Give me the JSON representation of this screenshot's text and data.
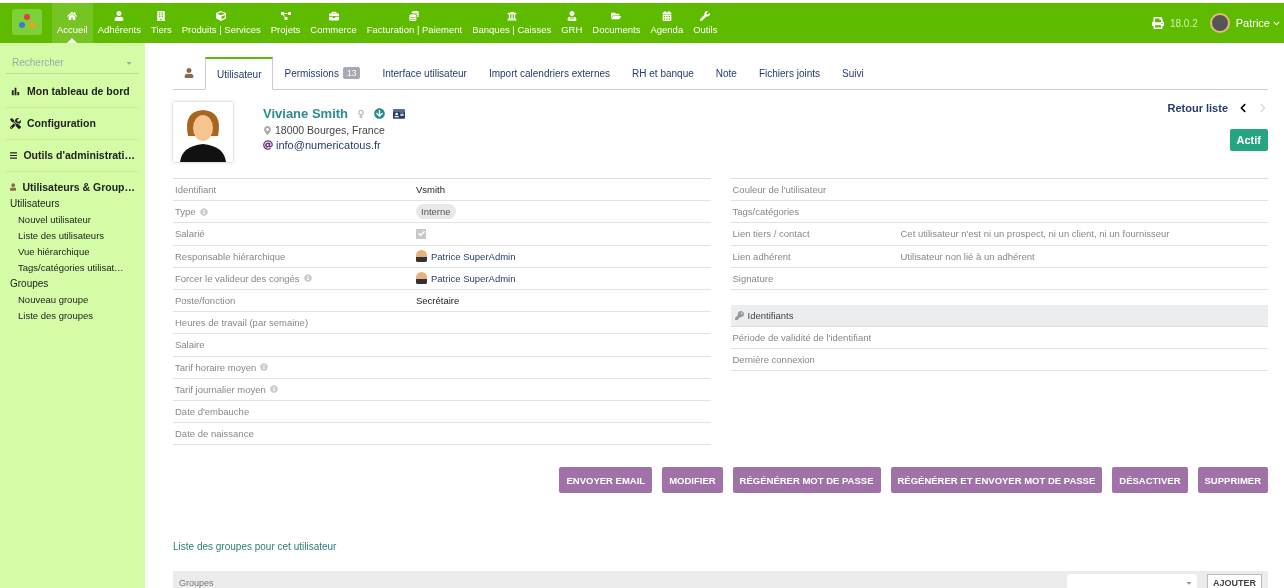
{
  "topbar": {
    "menu": [
      {
        "label": "Accueil",
        "selected": true
      },
      {
        "label": "Adhérents",
        "selected": false
      },
      {
        "label": "Tiers",
        "selected": false
      },
      {
        "label": "Produits | Services",
        "selected": false
      },
      {
        "label": "Projets",
        "selected": false
      },
      {
        "label": "Commerce",
        "selected": false
      },
      {
        "label": "Facturation | Paiement",
        "selected": false
      },
      {
        "label": "Banques | Caisses",
        "selected": false
      },
      {
        "label": "GRH",
        "selected": false
      },
      {
        "label": "Documents",
        "selected": false
      },
      {
        "label": "Agenda",
        "selected": false
      },
      {
        "label": "Outils",
        "selected": false
      }
    ],
    "version": "18.0.2",
    "user": "Patrice"
  },
  "sidebar": {
    "search": {
      "placeholder": "Rechercher"
    },
    "sections": [
      {
        "label": "Mon tableau de bord"
      },
      {
        "label": "Configuration"
      },
      {
        "label": "Outils d'administrati…"
      }
    ],
    "current": {
      "label": "Utilisateurs & Group…",
      "groups": [
        {
          "label": "Utilisateurs",
          "children": [
            {
              "label": "Nouvel utilisateur"
            },
            {
              "label": "Liste des utilisateurs"
            },
            {
              "label": "Vue hiérarchique"
            },
            {
              "label": "Tags/catégories utilisat…"
            }
          ]
        },
        {
          "label": "Groupes",
          "children": [
            {
              "label": "Nouveau groupe"
            },
            {
              "label": "Liste des groupes"
            }
          ]
        }
      ]
    }
  },
  "tabs": [
    {
      "label": "Utilisateur",
      "selected": true
    },
    {
      "label": "Permissions",
      "badge": "13",
      "selected": false
    },
    {
      "label": "Interface utilisateur",
      "selected": false
    },
    {
      "label": "Import calendriers externes",
      "selected": false
    },
    {
      "label": "RH et banque",
      "selected": false
    },
    {
      "label": "Note",
      "selected": false
    },
    {
      "label": "Fichiers joints",
      "selected": false
    },
    {
      "label": "Suivi",
      "selected": false
    }
  ],
  "profile": {
    "name": "Viviane Smith",
    "address": "18000 Bourges, France",
    "email": "info@numericatous.fr",
    "back_link": "Retour liste",
    "status": "Actif"
  },
  "left_fields": [
    {
      "label": "Identifiant",
      "info": false,
      "kind": "text",
      "value": "Vsmith"
    },
    {
      "label": "Type",
      "info": true,
      "kind": "badge",
      "value": "Interne"
    },
    {
      "label": "Salarié",
      "info": false,
      "kind": "checkbox",
      "checked": true
    },
    {
      "label": "Responsable hiérarchique",
      "info": false,
      "kind": "user",
      "value": "Patrice SuperAdmin"
    },
    {
      "label": "Forcer le valideur des congés",
      "info": true,
      "kind": "user",
      "value": "Patrice SuperAdmin"
    },
    {
      "label": "Poste/fonction",
      "info": false,
      "kind": "text",
      "value": "Secrétaire"
    },
    {
      "label": "Heures de travail (par semaine)",
      "info": false,
      "kind": "empty"
    },
    {
      "label": "Salaire",
      "info": false,
      "kind": "empty"
    },
    {
      "label": "Tarif horaire moyen",
      "info": true,
      "kind": "empty"
    },
    {
      "label": "Tarif journalier moyen",
      "info": true,
      "kind": "empty"
    },
    {
      "label": "Date d'embauche",
      "info": false,
      "kind": "empty"
    },
    {
      "label": "Date de naissance",
      "info": false,
      "kind": "empty"
    }
  ],
  "right_fields": [
    {
      "label": "Couleur de l'utilisateur"
    },
    {
      "label": "Tags/catégories"
    },
    {
      "label": "Lien tiers / contact",
      "value": "Cet utilisateur n'est ni un prospect, ni un client, ni un fournisseur"
    },
    {
      "label": "Lien adhérent",
      "value": "Utilisateur non lié à un adhérent"
    },
    {
      "label": "Signature"
    }
  ],
  "credentials": {
    "title": "Identifiants",
    "fields": [
      {
        "label": "Période de validité de l'identifiant"
      },
      {
        "label": "Dernière connexion"
      }
    ]
  },
  "actions": [
    "ENVOYER EMAIL",
    "MODIFIER",
    "RÉGÉNÉRER MOT DE PASSE",
    "RÉGÉNÉRER ET ENVOYER MOT DE PASSE",
    "DÉSACTIVER",
    "SUPPRIMER"
  ],
  "groups_section": {
    "title": "Liste des groupes pour cet utilisateur",
    "column": "Groupes",
    "add_button": "AJOUTER"
  }
}
